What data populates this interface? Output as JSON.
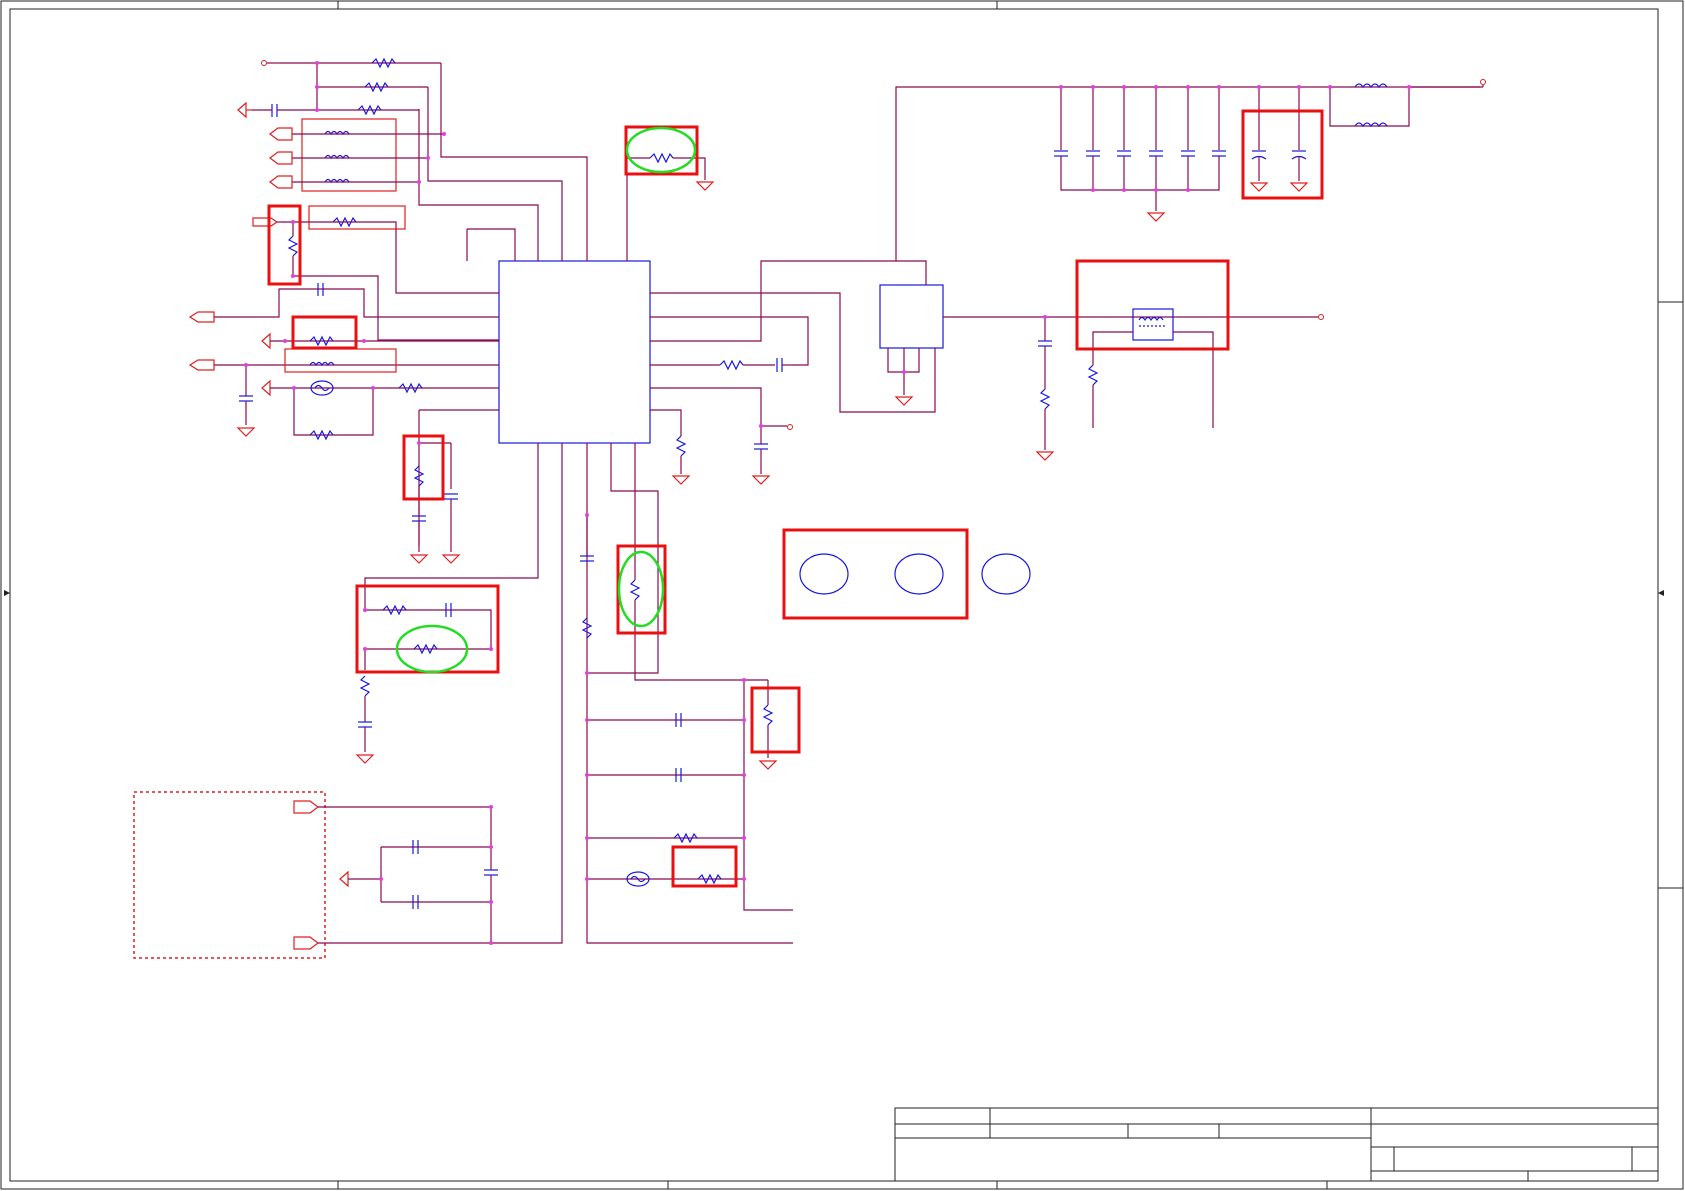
{
  "document": {
    "type": "electrical-schematic-sheet",
    "text_content": []
  },
  "colors": {
    "wire": "#8b0a50",
    "component": "#1818e0",
    "port_symbol": "#e02020",
    "highlight_box": "#e81010",
    "highlight_oval": "#22dd22",
    "junction_dot": "#e040e0",
    "frame": "#222222"
  },
  "components": {
    "ic_main": "integrated-circuit",
    "ic_secondary": "integrated-circuit",
    "transformer": "transformer-block",
    "connector_block": "dotted-connector-region",
    "mounting_holes": "mounting-hole",
    "title_block": "title-block"
  },
  "highlights": {
    "box_count": 12,
    "oval_count": 3
  }
}
